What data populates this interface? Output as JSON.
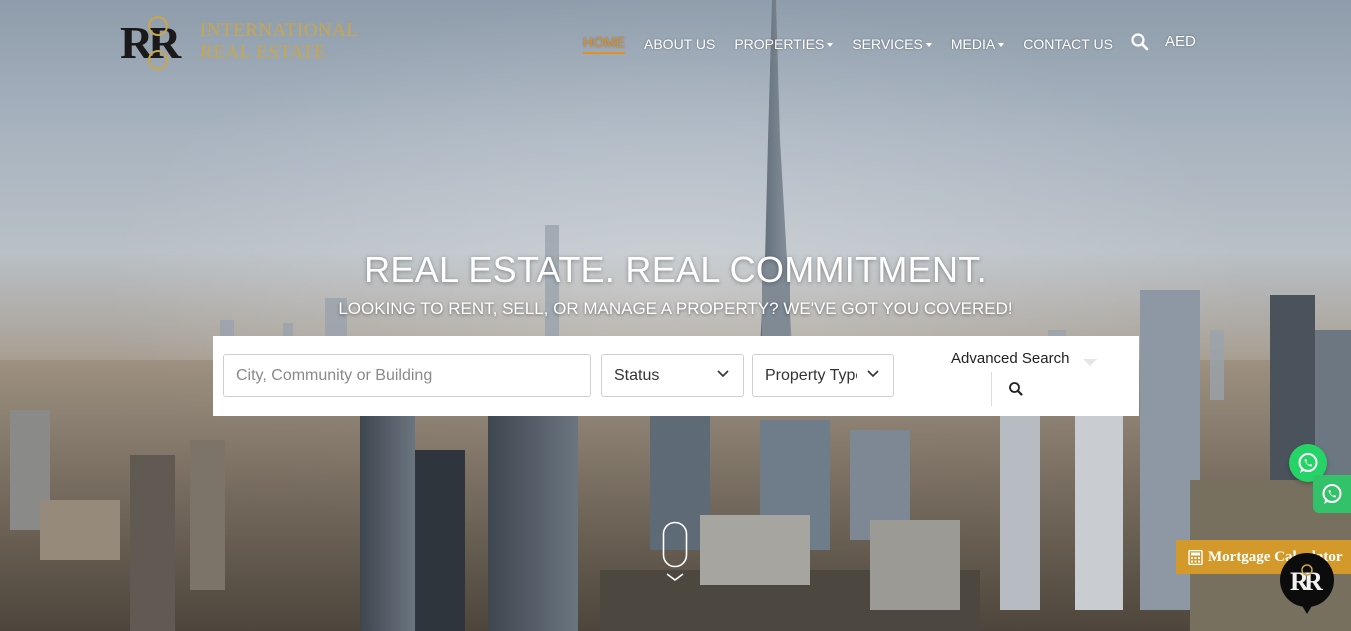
{
  "brand": {
    "line1": "INTERNATIONAL",
    "line2": "REAL ESTATE",
    "gold": "#c9a64a"
  },
  "nav": {
    "items": [
      {
        "label": "HOME",
        "active": true,
        "dropdown": false
      },
      {
        "label": "ABOUT US",
        "active": false,
        "dropdown": false
      },
      {
        "label": "PROPERTIES",
        "active": false,
        "dropdown": true
      },
      {
        "label": "SERVICES",
        "active": false,
        "dropdown": true
      },
      {
        "label": "MEDIA",
        "active": false,
        "dropdown": true
      },
      {
        "label": "CONTACT US",
        "active": false,
        "dropdown": false
      }
    ],
    "search_icon": "search-icon",
    "currency": "AED",
    "accent": "#e0911f"
  },
  "hero": {
    "title": "REAL ESTATE. REAL COMMITMENT.",
    "subtitle": "LOOKING TO RENT, SELL, OR MANAGE A PROPERTY? WE'VE GOT YOU COVERED!"
  },
  "search": {
    "location_placeholder": "City, Community or Building",
    "status_value": "Status",
    "property_type_value": "Property Type",
    "advanced_label": "Advanced Search",
    "submit_icon": "search-icon"
  },
  "widgets": {
    "whatsapp_icon": "whatsapp-icon",
    "whatsapp_color": "#25d366",
    "mortgage_label": "Mortgage Calculator",
    "mortgage_color": "#d39a2b",
    "chat_icon": "chat-icon"
  }
}
